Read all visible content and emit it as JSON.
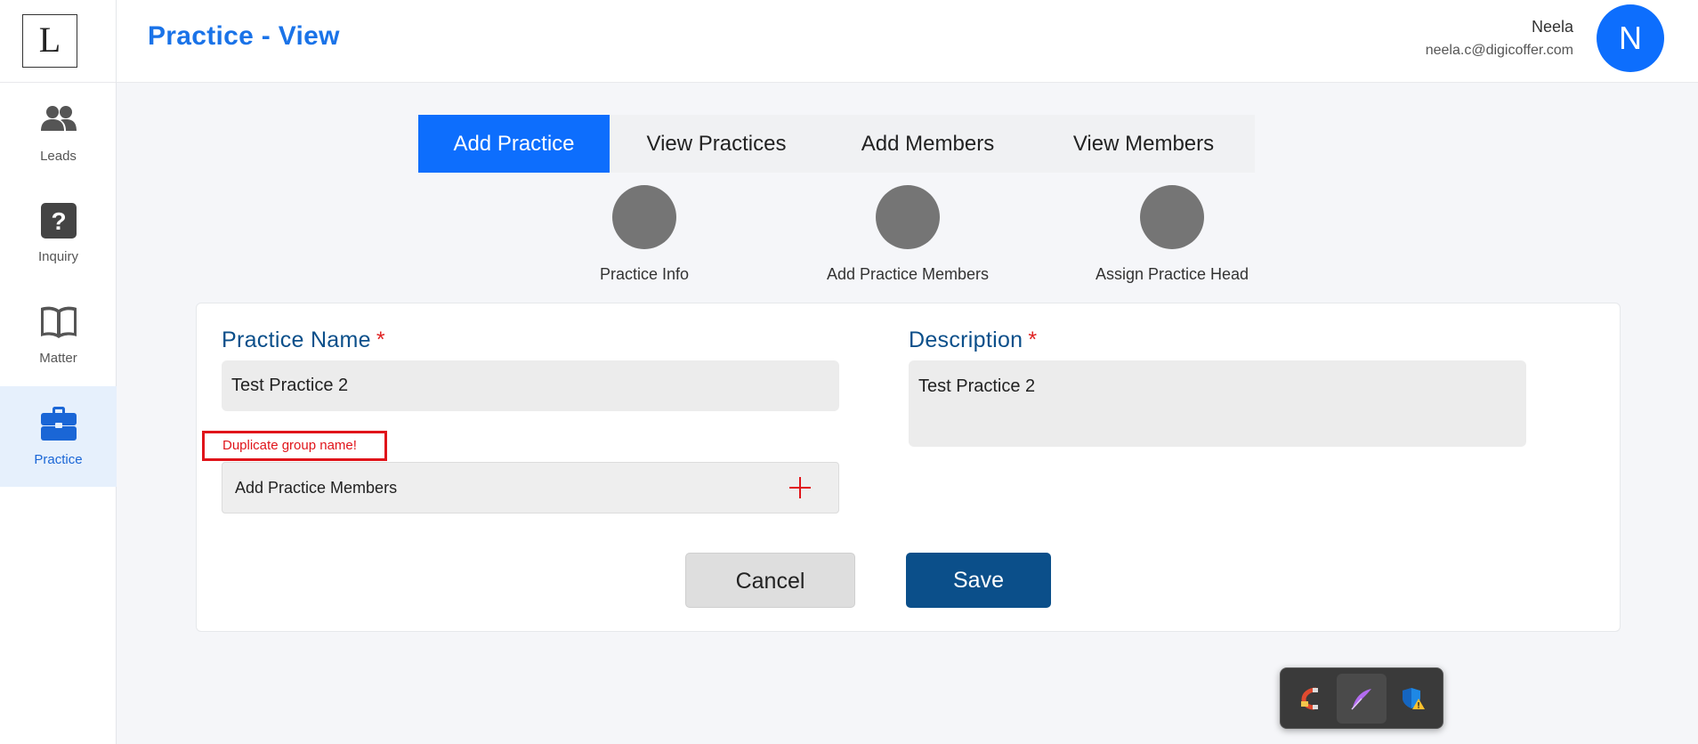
{
  "app": {
    "logo_letter": "L",
    "page_title": "Practice - View"
  },
  "user": {
    "name": "Neela",
    "email": "neela.c@digicoffer.com",
    "avatar_letter": "N"
  },
  "sidebar": {
    "items": [
      {
        "label": "Leads",
        "icon": "people-icon",
        "active": false
      },
      {
        "label": "Inquiry",
        "icon": "question-icon",
        "active": false
      },
      {
        "label": "Matter",
        "icon": "book-icon",
        "active": false
      },
      {
        "label": "Practice",
        "icon": "briefcase-icon",
        "active": true
      }
    ]
  },
  "tabs": [
    {
      "label": "Add Practice",
      "active": true
    },
    {
      "label": "View Practices",
      "active": false
    },
    {
      "label": "Add Members",
      "active": false
    },
    {
      "label": "View Members",
      "active": false
    }
  ],
  "steps": [
    {
      "label": "Practice Info"
    },
    {
      "label": "Add Practice Members"
    },
    {
      "label": "Assign Practice Head"
    }
  ],
  "form": {
    "practice_name_label": "Practice Name",
    "practice_name_value": "Test Practice 2",
    "description_label": "Description",
    "description_value": "Test Practice 2",
    "required_mark": "*",
    "error_message": "Duplicate group name!",
    "add_members_label": "Add Practice Members",
    "cancel_label": "Cancel",
    "save_label": "Save"
  },
  "colors": {
    "primary": "#0d6efd",
    "title_blue": "#1a73e8",
    "label_navy": "#0b4f8a",
    "error_red": "#e0141a",
    "step_gray": "#757575"
  },
  "float_toolbar": {
    "icons": [
      "magnet-tool-icon",
      "feather-pen-icon",
      "shield-warning-icon"
    ]
  }
}
